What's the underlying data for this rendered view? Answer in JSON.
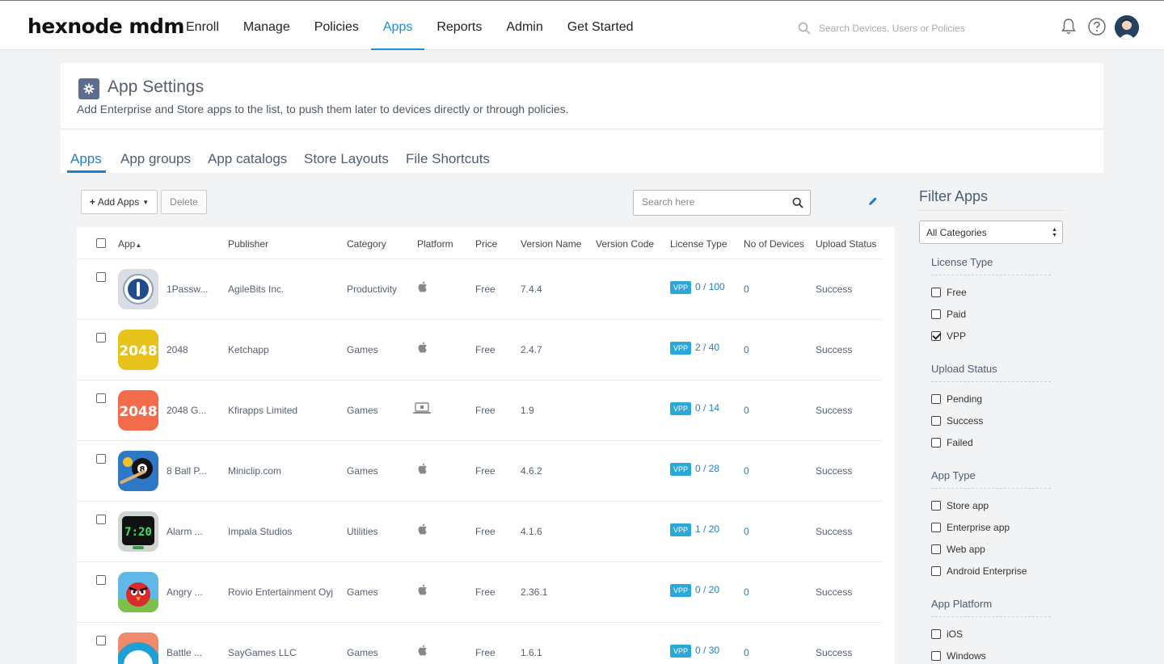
{
  "brand": {
    "logo_text": "hexnode mdm"
  },
  "nav": {
    "items": [
      {
        "label": "Enroll"
      },
      {
        "label": "Manage"
      },
      {
        "label": "Policies"
      },
      {
        "label": "Apps",
        "active": true
      },
      {
        "label": "Reports"
      },
      {
        "label": "Admin"
      },
      {
        "label": "Get Started"
      }
    ]
  },
  "global_search": {
    "placeholder": "Search Devices, Users or Policies"
  },
  "header": {
    "title": "App Settings",
    "subtitle": "Add Enterprise and Store apps to the list, to push them later to devices directly or through policies."
  },
  "tabs": [
    {
      "label": "Apps",
      "active": true
    },
    {
      "label": "App groups"
    },
    {
      "label": "App catalogs"
    },
    {
      "label": "Store Layouts"
    },
    {
      "label": "File Shortcuts"
    }
  ],
  "toolbar": {
    "add_apps_label": "Add Apps",
    "delete_label": "Delete",
    "search_placeholder": "Search here"
  },
  "table": {
    "columns": [
      "App",
      "Publisher",
      "Category",
      "Platform",
      "Price",
      "Version Name",
      "Version Code",
      "License Type",
      "No of Devices",
      "Upload Status"
    ],
    "rows": [
      {
        "app": "1Passw...",
        "publisher": "AgileBits Inc.",
        "category": "Productivity",
        "platform": "apple-icon",
        "price": "Free",
        "version": "7.4.4",
        "code": "",
        "badge": "VPP",
        "license": "0 / 100",
        "devices": "0",
        "status": "Success",
        "icon": "onepassword-icon"
      },
      {
        "app": "2048",
        "publisher": "Ketchapp",
        "category": "Games",
        "platform": "apple-icon",
        "price": "Free",
        "version": "2.4.7",
        "code": "",
        "badge": "VPP",
        "license": "2 / 40",
        "devices": "0",
        "status": "Success",
        "icon": "2048-yellow-icon"
      },
      {
        "app": "2048 G...",
        "publisher": "Kfirapps Limited",
        "category": "Games",
        "platform": "laptop-icon",
        "price": "Free",
        "version": "1.9",
        "code": "",
        "badge": "VPP",
        "license": "0 / 14",
        "devices": "0",
        "status": "Success",
        "icon": "2048-orange-icon"
      },
      {
        "app": "8 Ball P...",
        "publisher": "Miniclip.com",
        "category": "Games",
        "platform": "apple-icon",
        "price": "Free",
        "version": "4.6.2",
        "code": "",
        "badge": "VPP",
        "license": "0 / 28",
        "devices": "0",
        "status": "Success",
        "icon": "8ball-icon"
      },
      {
        "app": "Alarm ...",
        "publisher": "Impala Studios",
        "category": "Utilities",
        "platform": "apple-icon",
        "price": "Free",
        "version": "4.1.6",
        "code": "",
        "badge": "VPP",
        "license": "1 / 20",
        "devices": "0",
        "status": "Success",
        "icon": "alarm-clock-icon"
      },
      {
        "app": "Angry ...",
        "publisher": "Rovio Entertainment Oyj",
        "category": "Games",
        "platform": "apple-icon",
        "price": "Free",
        "version": "2.36.1",
        "code": "",
        "badge": "VPP",
        "license": "0 / 20",
        "devices": "0",
        "status": "Success",
        "icon": "angry-birds-icon"
      },
      {
        "app": "Battle ...",
        "publisher": "SayGames LLC",
        "category": "Games",
        "platform": "apple-icon",
        "price": "Free",
        "version": "1.6.1",
        "code": "",
        "badge": "VPP",
        "license": "0 / 30",
        "devices": "0",
        "status": "Success",
        "icon": "battle-icon"
      }
    ],
    "icon_texts": {
      "yellow": "2048",
      "orange": "2048",
      "ball": "8",
      "alarm": "7:20"
    }
  },
  "filter": {
    "title": "Filter Apps",
    "category_select": "All Categories",
    "groups": {
      "license": {
        "title": "License Type",
        "options": [
          {
            "label": "Free",
            "checked": false
          },
          {
            "label": "Paid",
            "checked": false
          },
          {
            "label": "VPP",
            "checked": true
          }
        ]
      },
      "upload": {
        "title": "Upload Status",
        "options": [
          {
            "label": "Pending"
          },
          {
            "label": "Success"
          },
          {
            "label": "Failed"
          }
        ]
      },
      "apptype": {
        "title": "App Type",
        "options": [
          {
            "label": "Store app"
          },
          {
            "label": "Enterprise app"
          },
          {
            "label": "Web app"
          },
          {
            "label": "Android Enterprise"
          }
        ]
      },
      "platform": {
        "title": "App Platform",
        "options": [
          {
            "label": "iOS"
          },
          {
            "label": "Windows"
          }
        ]
      }
    }
  },
  "colors": {
    "accent": "#1f8ed6",
    "vpp_badge": "#2aa8d8",
    "header_icon": "#5b6e8e"
  }
}
